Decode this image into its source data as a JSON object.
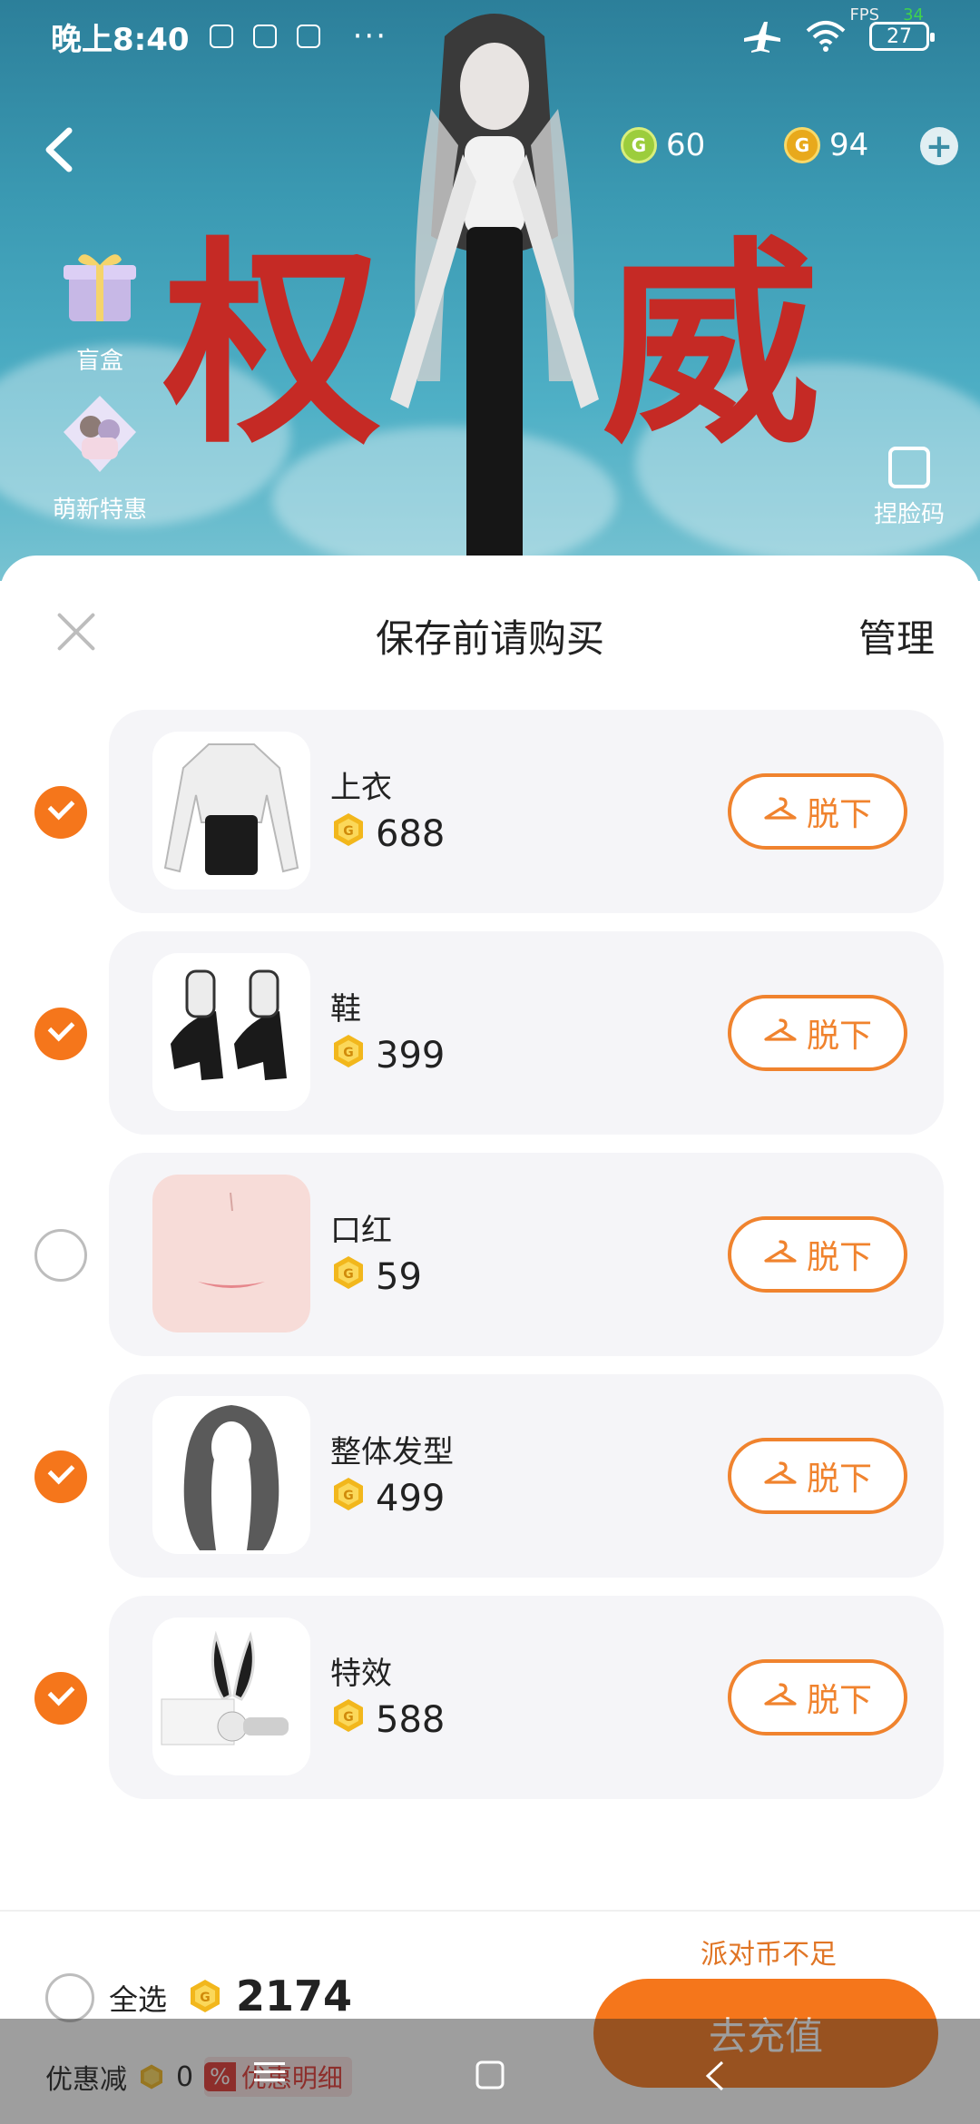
{
  "status_bar": {
    "time": "晚上8:40",
    "battery": "27",
    "fps_label": "FPS",
    "fps_value": "34"
  },
  "currencies": {
    "green_coin": "60",
    "gold_coin": "94"
  },
  "side_entries": [
    {
      "label": "盲盒"
    },
    {
      "label": "萌新特惠"
    }
  ],
  "face_code": {
    "label": "捏脸码"
  },
  "sheet": {
    "title": "保存前请购买",
    "manage_label": "管理",
    "remove_label": "脱下",
    "items": [
      {
        "name": "上衣",
        "price": "688",
        "checked": true
      },
      {
        "name": "鞋",
        "price": "399",
        "checked": true
      },
      {
        "name": "口红",
        "price": "59",
        "checked": false
      },
      {
        "name": "整体发型",
        "price": "499",
        "checked": true
      },
      {
        "name": "特效",
        "price": "588",
        "checked": true
      }
    ]
  },
  "footer": {
    "insufficient": "派对币不足",
    "select_all": "全选",
    "total": "2174",
    "recharge": "去充值",
    "discount_label": "优惠减",
    "discount_value": "0",
    "discount_detail": "优惠明细",
    "discount_pct": "%"
  },
  "colors": {
    "accent": "#f5761b",
    "accent_outline": "#f0832e",
    "card_bg": "#f5f5f8"
  }
}
